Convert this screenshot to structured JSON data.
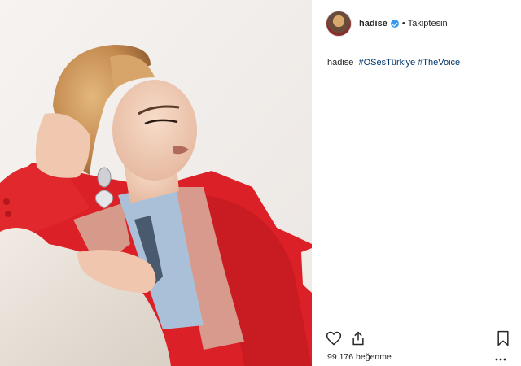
{
  "post": {
    "username": "hadise",
    "separator": "•",
    "follow_status": "Takiptesin",
    "caption_user": "hadise",
    "hashtags": [
      "#OSesTürkiye",
      "#TheVoice"
    ],
    "likes_count": "99.176",
    "likes_label": "beğenme"
  },
  "icons": {
    "verified": "verified-badge-icon",
    "like": "heart-icon",
    "share": "share-icon",
    "save": "bookmark-icon",
    "more": "more-options-icon"
  },
  "colors": {
    "verified": "#3897f0",
    "hashtag": "#003569",
    "text": "#262626",
    "jacket": "#e0262b",
    "lapel": "#d89a8c",
    "shirt": "#a9c0d8"
  }
}
